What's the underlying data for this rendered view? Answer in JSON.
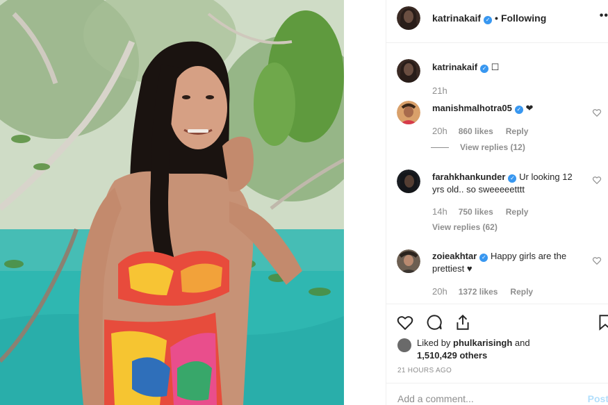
{
  "post": {
    "username": "katrinakaif",
    "following_label": "Following",
    "more_label": "••"
  },
  "caption": {
    "username": "katrinakaif",
    "text": "☐",
    "time": "21h"
  },
  "comments": [
    {
      "username": "manishmalhotra05",
      "text": "❤︎",
      "time": "20h",
      "likes": "860 likes",
      "reply_label": "Reply",
      "view_replies": "View replies (12)"
    },
    {
      "username": "farahkhankunder",
      "text": "Ur looking 12 yrs old.. so sweeeeetttt",
      "time": "14h",
      "likes": "750 likes",
      "reply_label": "Reply",
      "view_replies": "View replies (62)"
    },
    {
      "username": "zoieakhtar",
      "text": "Happy girls are the prettiest ♥",
      "time": "20h",
      "likes": "1372 likes",
      "reply_label": "Reply"
    }
  ],
  "likes": {
    "liked_by_prefix": "Liked by",
    "liked_by_user": "phulkarisingh",
    "and_label": "and",
    "others": "1,510,429 others"
  },
  "timestamp": "21 HOURS AGO",
  "add_comment": {
    "placeholder": "Add a comment...",
    "post_label": "Post"
  },
  "colors": {
    "verified": "#3897f0",
    "secondary_text": "#8e8e8e",
    "primary_text": "#262626"
  }
}
